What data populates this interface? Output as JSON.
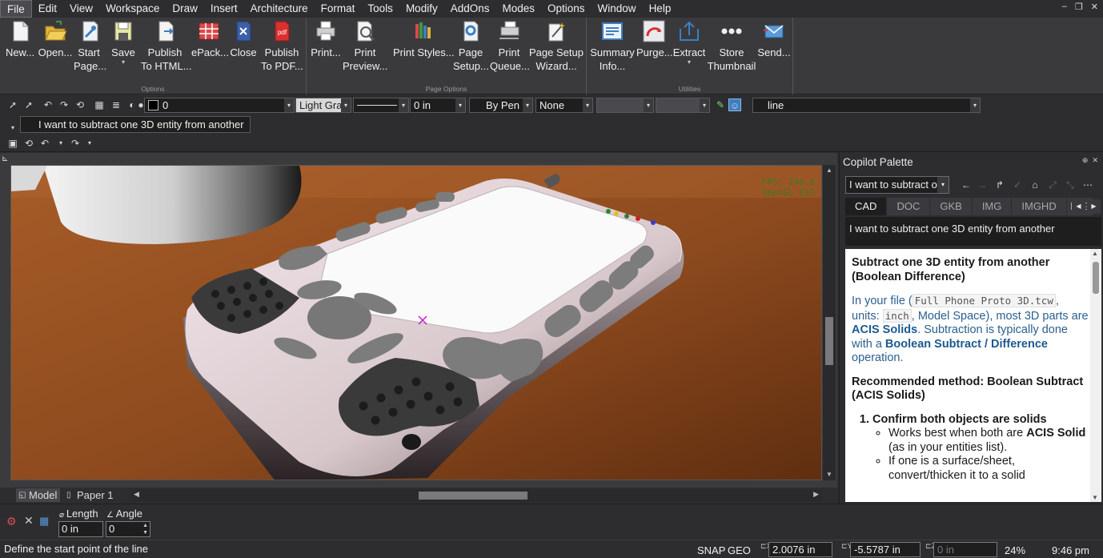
{
  "menu": [
    "File",
    "Edit",
    "View",
    "Workspace",
    "Draw",
    "Insert",
    "Architecture",
    "Format",
    "Tools",
    "Modify",
    "AddOns",
    "Modes",
    "Options",
    "Window",
    "Help"
  ],
  "menu_active": "File",
  "ribbon": {
    "groups": [
      {
        "label": "Options",
        "buttons": [
          {
            "l1": "New...",
            "l2": ""
          },
          {
            "l1": "Open...",
            "l2": ""
          },
          {
            "l1": "Start",
            "l2": "Page..."
          },
          {
            "l1": "Save",
            "l2": ""
          },
          {
            "l1": "Publish",
            "l2": "To HTML..."
          },
          {
            "l1": "ePack...",
            "l2": ""
          },
          {
            "l1": "Close",
            "l2": ""
          },
          {
            "l1": "Publish",
            "l2": "To PDF..."
          }
        ]
      },
      {
        "label": "Page Options",
        "buttons": [
          {
            "l1": "Print...",
            "l2": ""
          },
          {
            "l1": "Print",
            "l2": "Preview..."
          },
          {
            "l1": "Print Styles...",
            "l2": ""
          },
          {
            "l1": "Page",
            "l2": "Setup..."
          },
          {
            "l1": "Print",
            "l2": "Queue..."
          },
          {
            "l1": "Page Setup",
            "l2": "Wizard..."
          }
        ]
      },
      {
        "label": "Utilities",
        "buttons": [
          {
            "l1": "Summary",
            "l2": "Info..."
          },
          {
            "l1": "Purge...",
            "l2": ""
          },
          {
            "l1": "Extract",
            "l2": ""
          },
          {
            "l1": "Store",
            "l2": "Thumbnail"
          },
          {
            "l1": "Send...",
            "l2": ""
          }
        ]
      }
    ]
  },
  "toolbar": {
    "layer_value": "0",
    "color_value": "Light Gray",
    "linewidth_value": "0 in",
    "linestyle_value": "By Pen",
    "pattern_value": "None",
    "command_value": "line"
  },
  "copilot_query_bar": "I want to subtract one 3D entity from another",
  "viewport": {
    "fps": "FPS: 246.6",
    "renderer": "OpenGL ES2"
  },
  "layout_tabs": [
    "Model",
    "Paper 1"
  ],
  "copilot": {
    "title": "Copilot Palette",
    "query": "I want to subtract one 3D entity from another",
    "tabs": [
      "CAD",
      "DOC",
      "GKB",
      "IMG",
      "IMGHD",
      "IMG"
    ],
    "echo": "I want to subtract one 3D entity from another",
    "answer": {
      "heading": "Subtract one 3D entity from another (Boolean Difference)",
      "p1_a": "In your file (",
      "p1_file": "Full Phone Proto 3D.tcw",
      "p1_b": ", units: ",
      "p1_units": "inch",
      "p1_c": ", Model Space), most 3D parts are ",
      "p1_solids": "ACIS Solids",
      "p1_d": ". Subtraction is typically done with a ",
      "p1_op": "Boolean Subtract / Difference",
      "p1_e": " operation.",
      "heading2": "Recommended method: Boolean Subtract (ACIS Solids)",
      "step1": "Confirm both objects are solids",
      "step1_b1_a": "Works best when both are ",
      "step1_b1_bold": "ACIS Solid",
      "step1_b1_c": " (as in your entities list).",
      "step1_b2": "If one is a surface/sheet, convert/thicken it to a solid"
    }
  },
  "inspector": {
    "length_label": "Length",
    "angle_label": "Angle",
    "length_value": "0 in",
    "angle_value": "0"
  },
  "status": {
    "prompt": "Define the start point of the line",
    "snap": "SNAP",
    "geo": "GEO",
    "x": "2.0076 in",
    "y": "-5.5787 in",
    "z": "0 in",
    "zoom": "24%",
    "time": "9:46 pm"
  },
  "colors": {
    "accent": "#3c7fc1",
    "table_top": "#8a4b20",
    "device": "#d9cfd2"
  }
}
